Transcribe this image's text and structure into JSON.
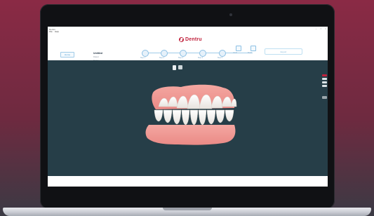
{
  "window": {
    "title": "Dentru",
    "menu": [
      "File",
      "Help"
    ],
    "controls": [
      "–",
      "□",
      "×"
    ]
  },
  "header": {
    "brand": "Dentru",
    "home_label": "Home",
    "case": {
      "name": "Untitled",
      "line2": "Patient",
      "line3": "Doctor"
    },
    "steps": [
      {
        "label": "Step 1"
      },
      {
        "label": "Step 2"
      },
      {
        "label": "Step 3"
      },
      {
        "label": "Step 4"
      },
      {
        "label": "Step 5"
      }
    ],
    "tools": [
      {
        "label": "Undo"
      },
      {
        "label": "Redo"
      }
    ],
    "export_label": "Export"
  },
  "colors": {
    "brand": "#c0213c",
    "accent": "#4d9fd6",
    "viewport_bg": "#263e48"
  },
  "icons": {
    "toolbar": [
      "document-icon",
      "camera-icon"
    ]
  }
}
